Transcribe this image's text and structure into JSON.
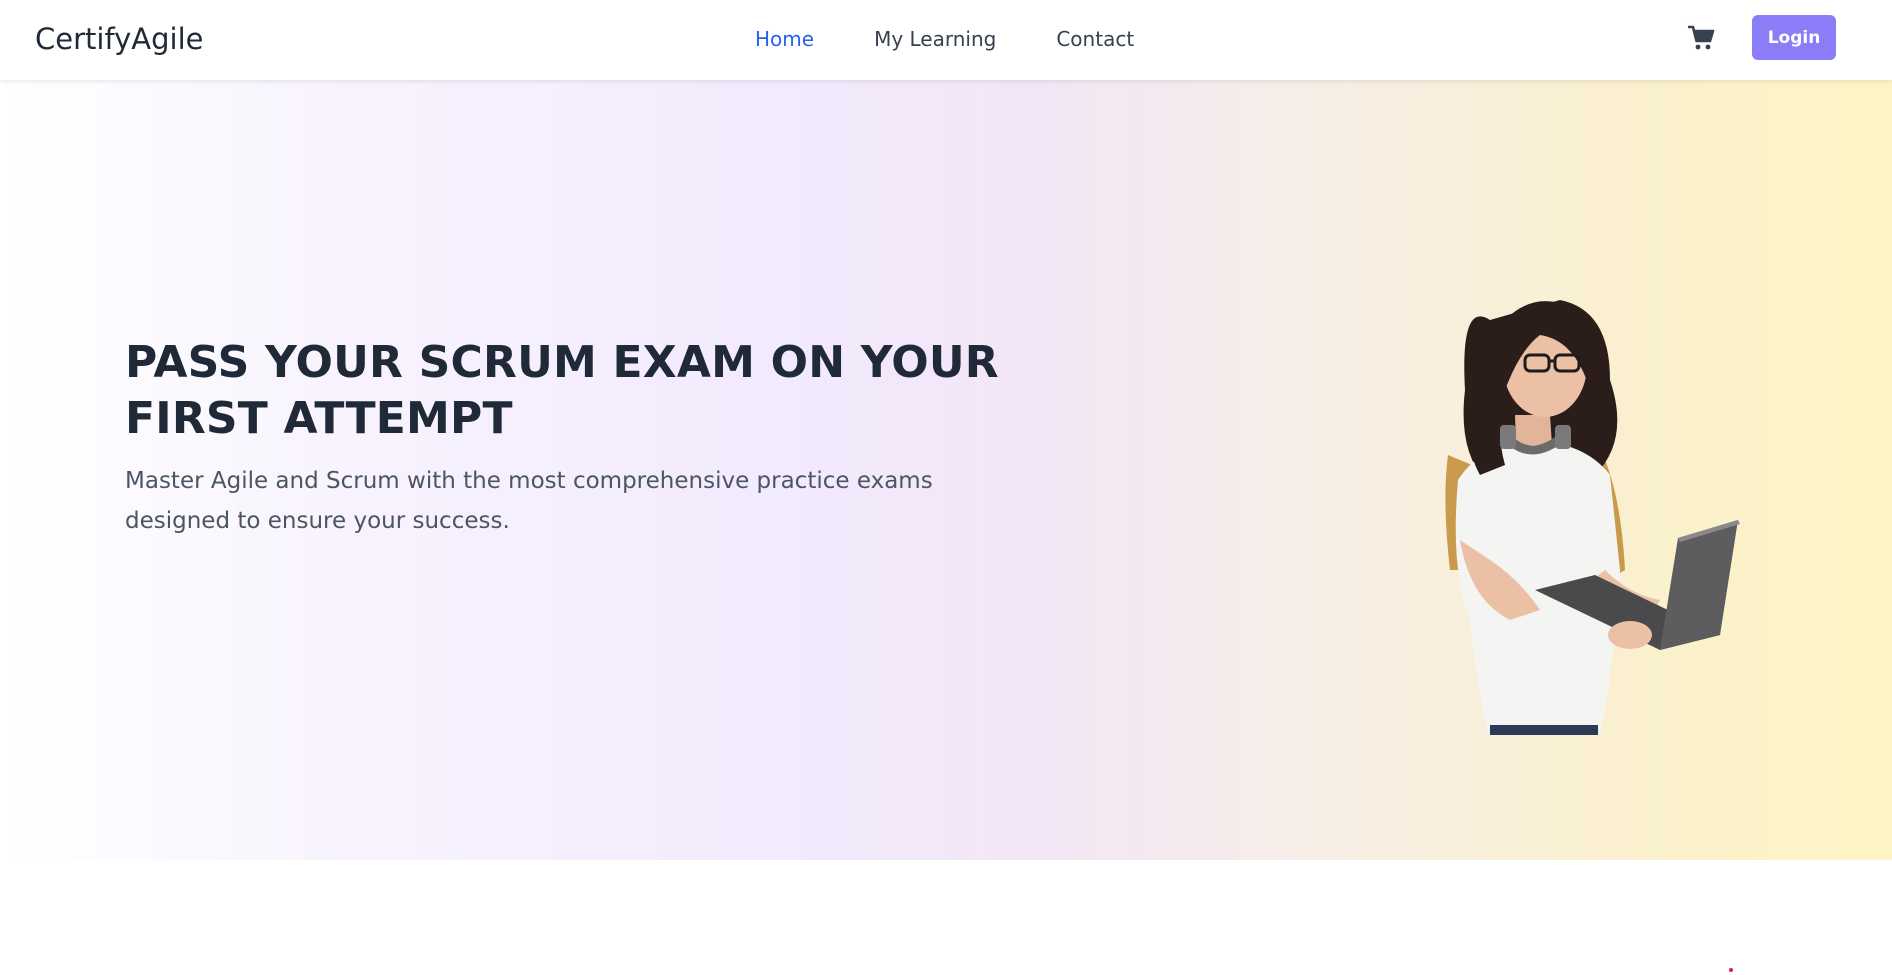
{
  "nav": {
    "brand": "CertifyAgile",
    "links": [
      {
        "label": "Home",
        "active": true
      },
      {
        "label": "My Learning",
        "active": false
      },
      {
        "label": "Contact",
        "active": false
      }
    ],
    "cart_icon": "shopping-cart-icon",
    "login_label": "Login"
  },
  "hero": {
    "title": "PASS YOUR SCRUM EXAM ON YOUR FIRST ATTEMPT",
    "subtitle": "Master Agile and Scrum with the most comprehensive practice exams designed to ensure your success."
  },
  "colors": {
    "accent": "#2563eb",
    "button": "#8b7cf8",
    "text_dark": "#1f2937",
    "text_muted": "#4b5563"
  }
}
